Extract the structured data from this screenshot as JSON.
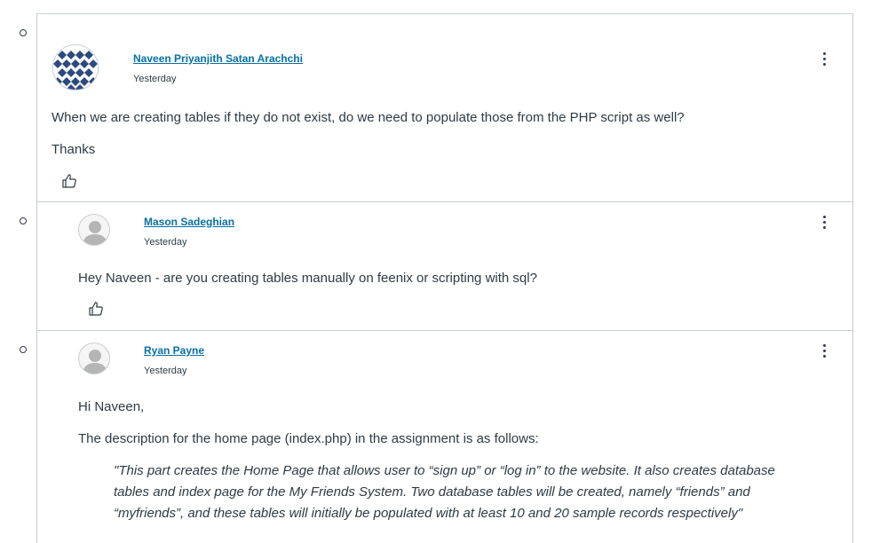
{
  "posts": [
    {
      "author": "Naveen Priyanjith Satan Arachchi",
      "date": "Yesterday",
      "avatar": "pattern-avatar",
      "body": [
        "When we are creating tables if they do not exist, do we need to populate those from the PHP script as well?",
        "Thanks"
      ]
    },
    {
      "author": "Mason Sadeghian",
      "date": "Yesterday",
      "avatar": "default-avatar",
      "body": [
        "Hey Naveen - are you creating tables manually on feenix or scripting with sql?"
      ]
    },
    {
      "author": "Ryan Payne",
      "date": "Yesterday",
      "avatar": "default-avatar",
      "body": [
        "Hi Naveen,",
        "The description for the home page (index.php) in the assignment is as follows:"
      ],
      "quote": [
        "\"This part creates the Home Page that allows user to “sign up” or “log in” to the website. It also creates database",
        "tables and index page for the My Friends System. Two database tables will be created, namely “friends” and",
        "“myfriends”, and these tables will initially be populated with at least 10 and 20 sample records respectively\""
      ]
    }
  ],
  "colors": {
    "link": "#0770a3",
    "text": "#2d3b45",
    "border": "#c7cdd1",
    "avatar_pattern": "#2b4a7e"
  },
  "icons": {
    "menu": "kebab-menu-icon",
    "like": "thumbs-up-icon",
    "thread": "thread-bullet-icon"
  }
}
